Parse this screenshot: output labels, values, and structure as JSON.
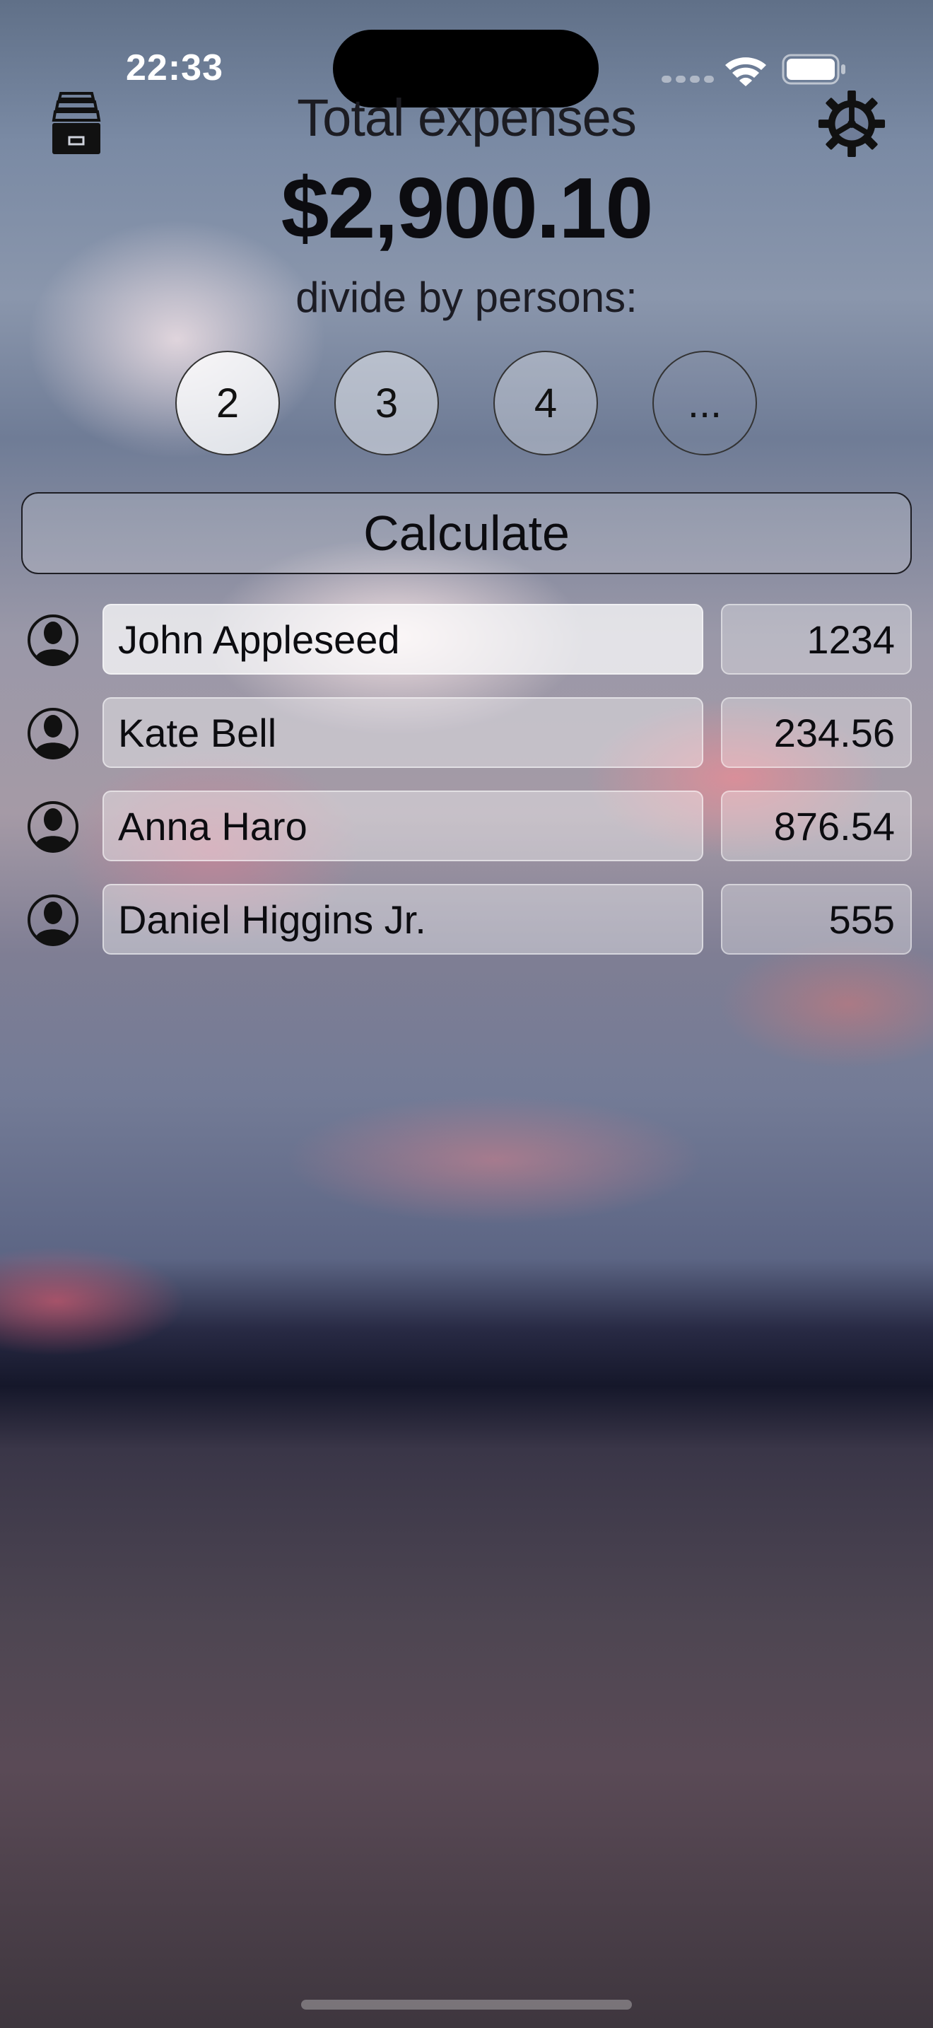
{
  "status_bar": {
    "time": "22:33"
  },
  "header": {
    "title": "Total expenses",
    "total": "$2,900.10",
    "subtitle": "divide by persons:",
    "archive_icon": "archive-drawer-icon",
    "settings_icon": "gear-icon"
  },
  "person_options": [
    "2",
    "3",
    "4",
    "..."
  ],
  "calculate_label": "Calculate",
  "expenses": [
    {
      "name": "John Appleseed",
      "amount": "1234"
    },
    {
      "name": "Kate Bell",
      "amount": "234.56"
    },
    {
      "name": "Anna Haro",
      "amount": "876.54"
    },
    {
      "name": "Daniel Higgins Jr.",
      "amount": "555"
    }
  ],
  "colors": {
    "text": "#0c0c10",
    "title_text": "#1c1c22",
    "status_text": "#ffffff"
  }
}
